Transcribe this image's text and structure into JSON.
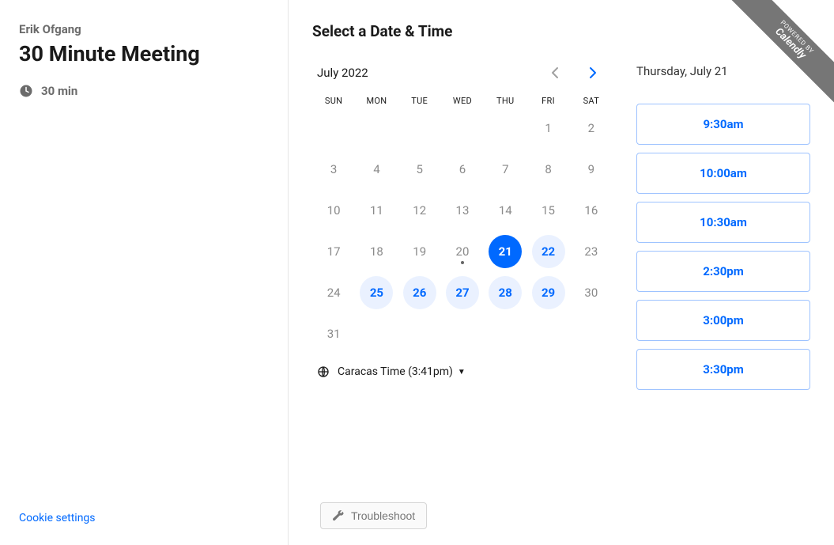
{
  "ribbon": {
    "powered_by": "POWERED BY",
    "brand": "Calendly"
  },
  "sidebar": {
    "host": "Erik Ofgang",
    "title": "30 Minute Meeting",
    "duration": "30 min",
    "cookie_settings": "Cookie settings"
  },
  "main": {
    "heading": "Select a Date & Time",
    "month_label": "July 2022",
    "dow": [
      "SUN",
      "MON",
      "TUE",
      "WED",
      "THU",
      "FRI",
      "SAT"
    ],
    "days": [
      {
        "n": "",
        "state": "blank"
      },
      {
        "n": "",
        "state": "blank"
      },
      {
        "n": "",
        "state": "blank"
      },
      {
        "n": "",
        "state": "blank"
      },
      {
        "n": "",
        "state": "blank"
      },
      {
        "n": "1",
        "state": "past"
      },
      {
        "n": "2",
        "state": "past"
      },
      {
        "n": "3",
        "state": "past"
      },
      {
        "n": "4",
        "state": "past"
      },
      {
        "n": "5",
        "state": "past"
      },
      {
        "n": "6",
        "state": "past"
      },
      {
        "n": "7",
        "state": "past"
      },
      {
        "n": "8",
        "state": "past"
      },
      {
        "n": "9",
        "state": "past"
      },
      {
        "n": "10",
        "state": "past"
      },
      {
        "n": "11",
        "state": "past"
      },
      {
        "n": "12",
        "state": "past"
      },
      {
        "n": "13",
        "state": "past"
      },
      {
        "n": "14",
        "state": "past"
      },
      {
        "n": "15",
        "state": "past"
      },
      {
        "n": "16",
        "state": "past"
      },
      {
        "n": "17",
        "state": "past"
      },
      {
        "n": "18",
        "state": "past"
      },
      {
        "n": "19",
        "state": "past"
      },
      {
        "n": "20",
        "state": "today"
      },
      {
        "n": "21",
        "state": "selected"
      },
      {
        "n": "22",
        "state": "avail"
      },
      {
        "n": "23",
        "state": "past"
      },
      {
        "n": "24",
        "state": "past"
      },
      {
        "n": "25",
        "state": "avail"
      },
      {
        "n": "26",
        "state": "avail"
      },
      {
        "n": "27",
        "state": "avail"
      },
      {
        "n": "28",
        "state": "avail"
      },
      {
        "n": "29",
        "state": "avail"
      },
      {
        "n": "30",
        "state": "past"
      },
      {
        "n": "31",
        "state": "past"
      }
    ],
    "timezone": "Caracas Time (3:41pm)",
    "selected_date": "Thursday, July 21",
    "slots": [
      "9:30am",
      "10:00am",
      "10:30am",
      "2:30pm",
      "3:00pm",
      "3:30pm"
    ],
    "troubleshoot": "Troubleshoot"
  }
}
